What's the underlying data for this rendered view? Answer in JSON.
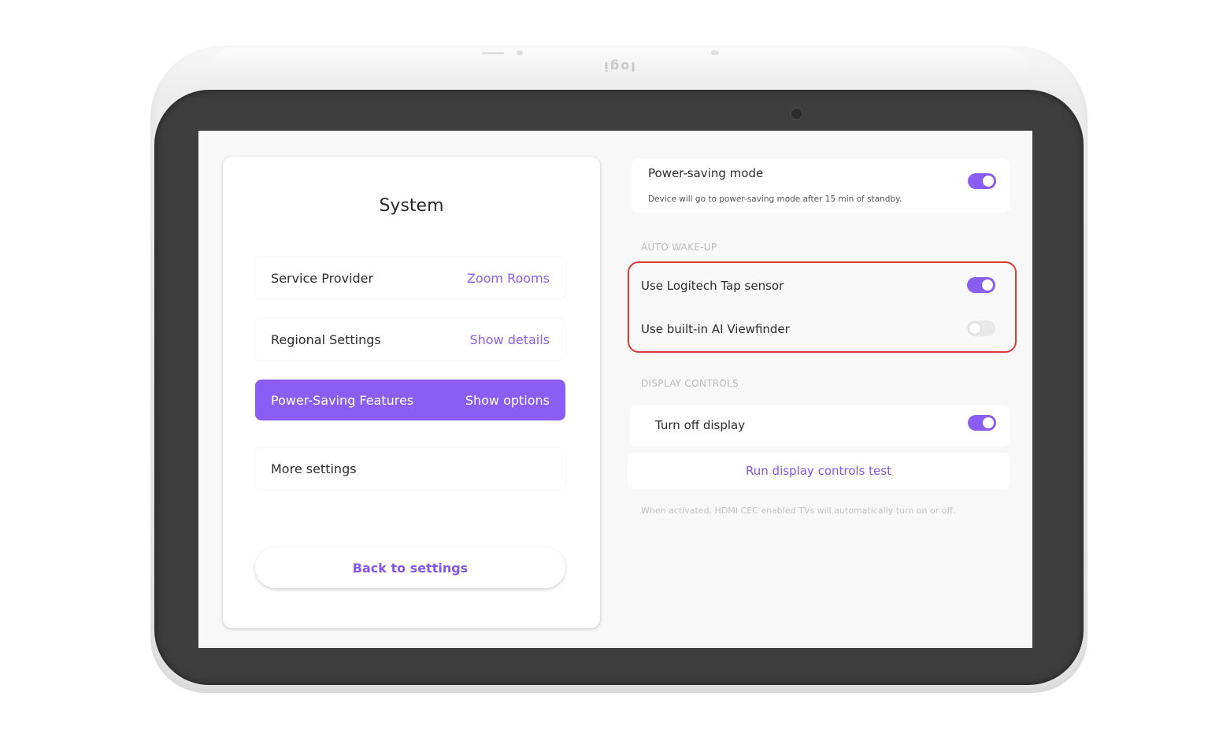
{
  "device": {
    "brand_logo": "logi"
  },
  "system_panel": {
    "title": "System",
    "rows": [
      {
        "label": "Service Provider",
        "value": "Zoom Rooms",
        "active": false
      },
      {
        "label": "Regional Settings",
        "value": "Show details",
        "active": false
      },
      {
        "label": "Power-Saving Features",
        "value": "Show options",
        "active": true
      },
      {
        "label": "More settings",
        "value": "",
        "active": false
      }
    ],
    "back_button": "Back to settings"
  },
  "power_saving": {
    "title": "Power-saving mode",
    "subtitle": "Device will go to power-saving mode after 15 min of standby.",
    "enabled": true
  },
  "auto_wake_up": {
    "header": "AUTO WAKE-UP",
    "options": [
      {
        "label": "Use Logitech Tap sensor",
        "enabled": true
      },
      {
        "label": "Use built-in AI Viewfinder",
        "enabled": false
      }
    ]
  },
  "display_controls": {
    "header": "DISPLAY CONTROLS",
    "turn_off_label": "Turn off display",
    "turn_off_enabled": true,
    "test_link": "Run display controls test",
    "hint": "When activated, HDMI CEC enabled TVs will automatically turn on or off."
  },
  "colors": {
    "accent": "#8a5ef2",
    "link": "#8355ea",
    "highlight_border": "#d93a3a",
    "bezel": "#3e3e3e"
  }
}
